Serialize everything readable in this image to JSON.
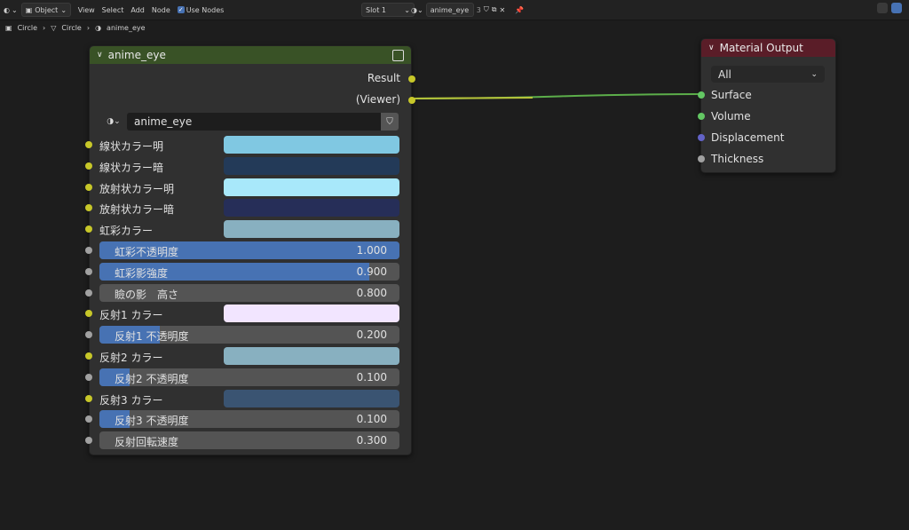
{
  "header": {
    "mode": "Object",
    "menu": [
      "View",
      "Select",
      "Add",
      "Node"
    ],
    "use_nodes_label": "Use Nodes",
    "slot": "Slot 1",
    "material": "anime_eye",
    "users": "3"
  },
  "breadcrumb": [
    "Circle",
    "Circle",
    "anime_eye"
  ],
  "node": {
    "title": "anime_eye",
    "outputs": [
      "Result",
      "(Viewer)"
    ],
    "material_name": "anime_eye",
    "header_color": "#395226",
    "inputs": [
      {
        "type": "color",
        "label": "線状カラー明",
        "color": "#80c8e2"
      },
      {
        "type": "color",
        "label": "線状カラー暗",
        "color": "#233a58"
      },
      {
        "type": "color",
        "label": "放射状カラー明",
        "color": "#a8e8fa"
      },
      {
        "type": "color",
        "label": "放射状カラー暗",
        "color": "#262e58"
      },
      {
        "type": "color",
        "label": "虹彩カラー",
        "color": "#88b0c0"
      },
      {
        "type": "value",
        "label": "虹彩不透明度",
        "value": "1.000",
        "fill": 1.0
      },
      {
        "type": "value",
        "label": "虹彩影強度",
        "value": "0.900",
        "fill": 0.9
      },
      {
        "type": "value",
        "label": "瞼の影　高さ",
        "value": "0.800",
        "fill": 0.0
      },
      {
        "type": "color",
        "label": "反射1 カラー",
        "color": "#f2e5ff"
      },
      {
        "type": "value",
        "label": "反射1 不透明度",
        "value": "0.200",
        "fill": 0.2
      },
      {
        "type": "color",
        "label": "反射2 カラー",
        "color": "#88b0c0"
      },
      {
        "type": "value",
        "label": "反射2 不透明度",
        "value": "0.100",
        "fill": 0.1
      },
      {
        "type": "color",
        "label": "反射3 カラー",
        "color": "#3a5472"
      },
      {
        "type": "value",
        "label": "反射3 不透明度",
        "value": "0.100",
        "fill": 0.1
      },
      {
        "type": "value",
        "label": "反射回転速度",
        "value": "0.300",
        "fill": 0.0
      }
    ]
  },
  "material_output": {
    "title": "Material Output",
    "target": "All",
    "header_color": "#5a1d28",
    "inputs": [
      "Surface",
      "Volume",
      "Displacement",
      "Thickness"
    ]
  },
  "colors": {
    "link": "#7fc45a",
    "socket_color": "#c7c729",
    "socket_float": "#a1a1a1",
    "socket_shader": "#63c763",
    "socket_vector": "#6363c7",
    "accent": "#4772b3"
  }
}
